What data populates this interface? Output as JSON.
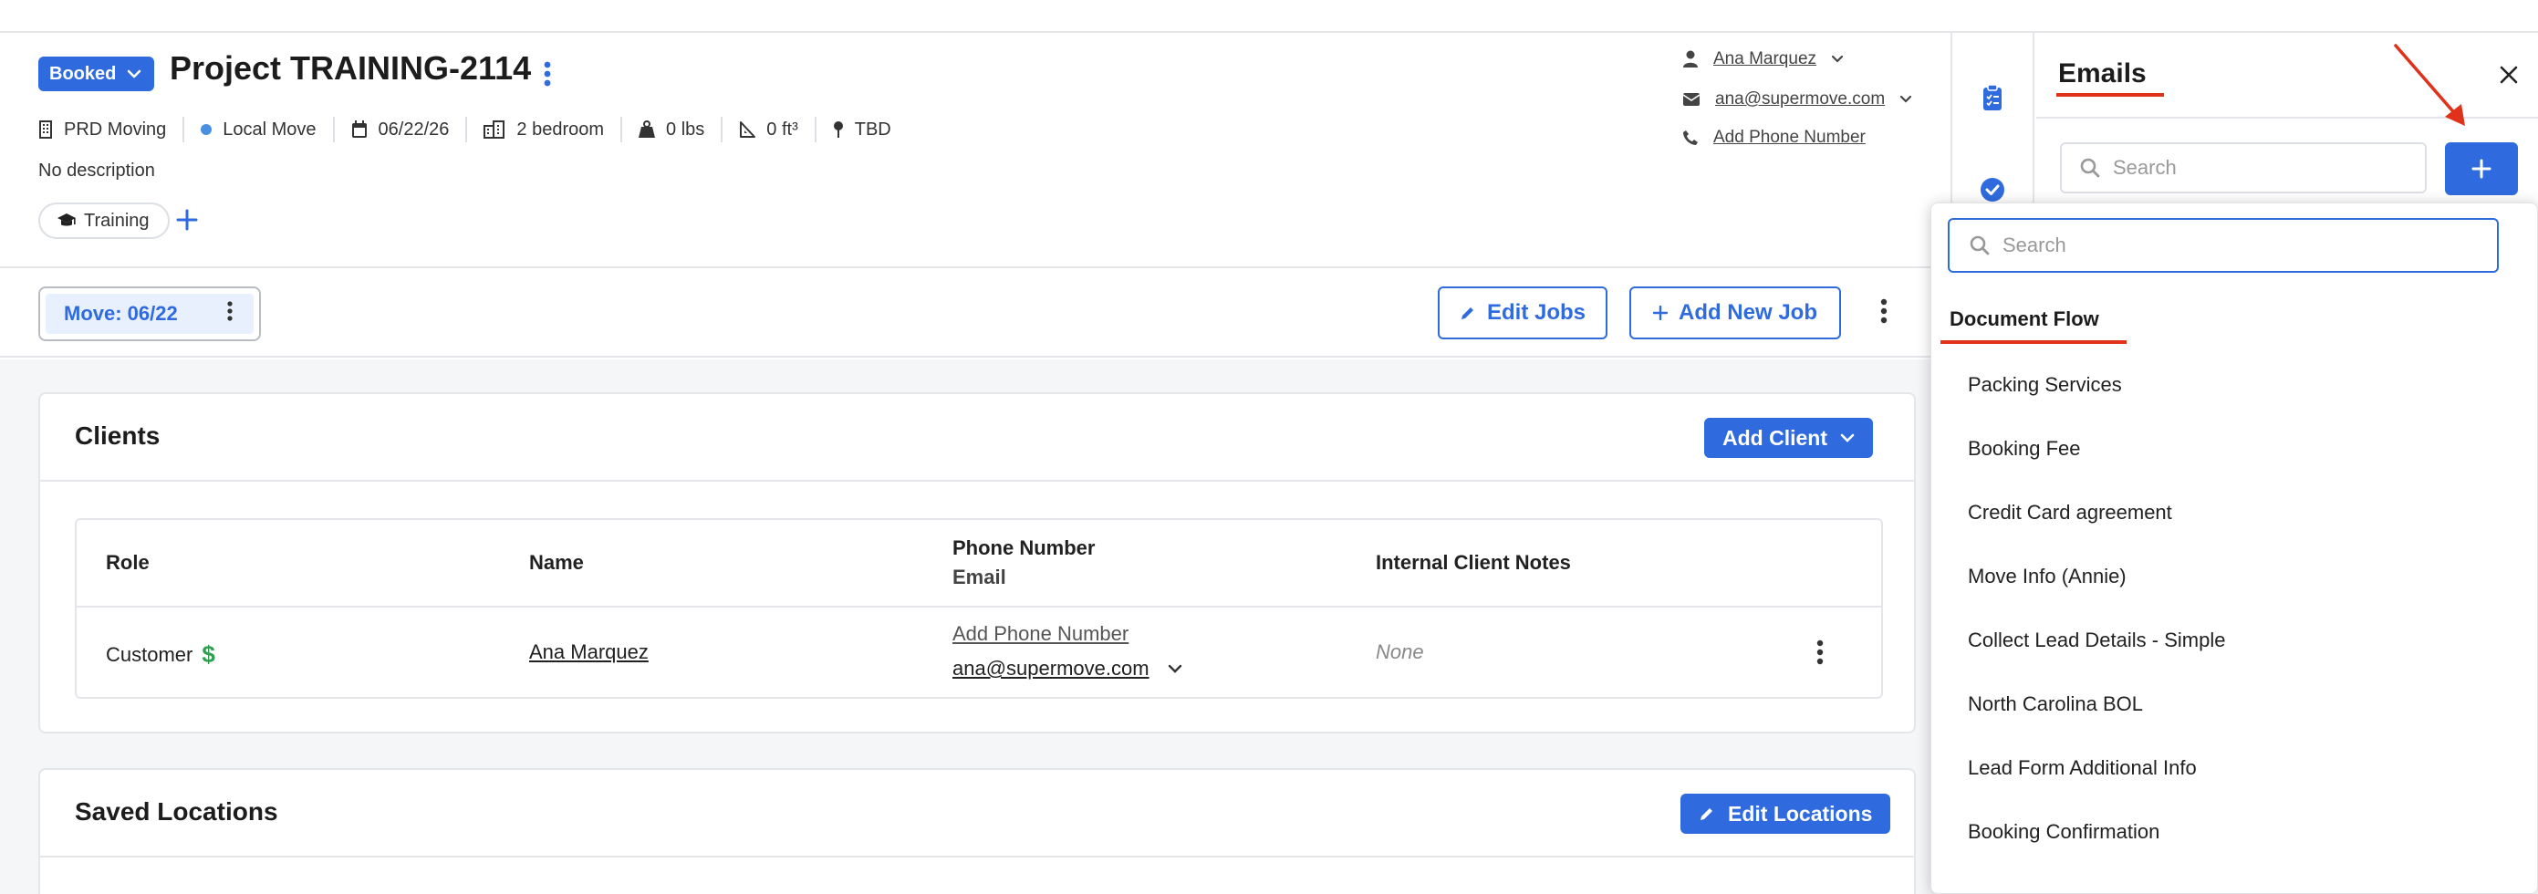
{
  "header": {
    "status": "Booked",
    "project_title": "Project TRAINING-2114",
    "meta": {
      "organization": "PRD Moving",
      "move_type": "Local Move",
      "date": "06/22/26",
      "bedrooms": "2 bedroom",
      "weight": "0 lbs",
      "volume": "0 ft³",
      "location": "TBD"
    },
    "description": "No description",
    "tag": "Training",
    "contact": {
      "name": "Ana Marquez",
      "email": "ana@supermove.com",
      "phone": "Add Phone Number"
    }
  },
  "move_bar": {
    "move_tab": "Move: 06/22",
    "edit_jobs": "Edit Jobs",
    "add_new_job": "Add New Job"
  },
  "clients": {
    "title": "Clients",
    "add_client": "Add Client",
    "columns": {
      "role": "Role",
      "name": "Name",
      "phone": "Phone Number",
      "email": "Email",
      "notes": "Internal Client Notes"
    },
    "rows": [
      {
        "role": "Customer",
        "name": "Ana Marquez",
        "phone": "Add Phone Number",
        "email": "ana@supermove.com",
        "notes": "None"
      }
    ]
  },
  "saved_locations": {
    "title": "Saved Locations",
    "edit_locations": "Edit Locations"
  },
  "emails_panel": {
    "title": "Emails",
    "search_placeholder": "Search"
  },
  "dropdown": {
    "search_placeholder": "Search",
    "heading": "Document Flow",
    "items": [
      "Packing Services",
      "Booking Fee",
      "Credit Card agreement",
      "Move Info (Annie)",
      "Collect Lead Details - Simple",
      "North Carolina BOL",
      "Lead Form Additional Info",
      "Booking Confirmation"
    ]
  },
  "colors": {
    "primary": "#2f6bdf",
    "annotation": "#e0311a",
    "success": "#2e9e4f"
  }
}
